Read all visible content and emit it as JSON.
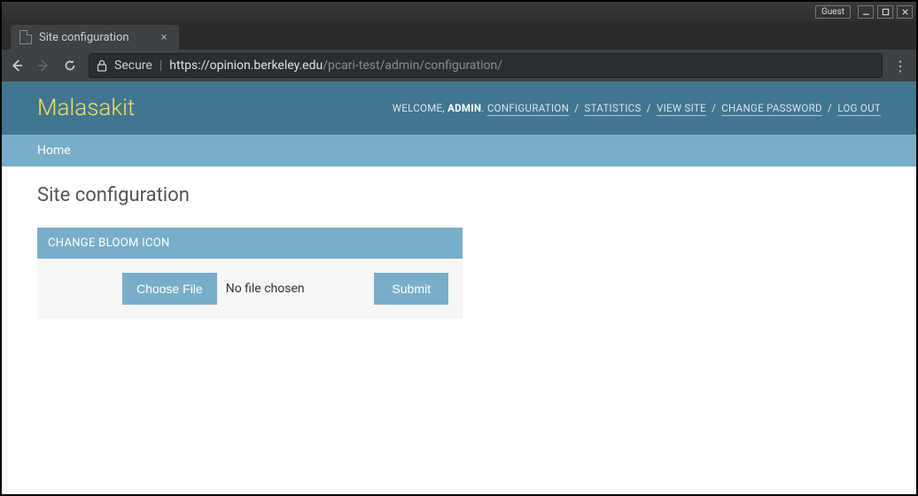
{
  "window": {
    "guest_label": "Guest"
  },
  "tab": {
    "title": "Site configuration"
  },
  "addressbar": {
    "secure_label": "Secure",
    "url_host": "https://opinion.berkeley.edu",
    "url_path": "/pcari-test/admin/configuration/"
  },
  "header": {
    "brand": "Malasakit",
    "welcome": "WELCOME, ",
    "admin": "ADMIN",
    "links": {
      "configuration": "CONFIGURATION",
      "statistics": "STATISTICS",
      "view_site": "VIEW SITE",
      "change_password": "CHANGE PASSWORD",
      "log_out": "LOG OUT"
    }
  },
  "breadcrumbs": {
    "home": "Home"
  },
  "page": {
    "title": "Site configuration"
  },
  "module": {
    "header": "CHANGE BLOOM ICON",
    "choose_label": "Choose File",
    "file_status": "No file chosen",
    "submit_label": "Submit"
  }
}
